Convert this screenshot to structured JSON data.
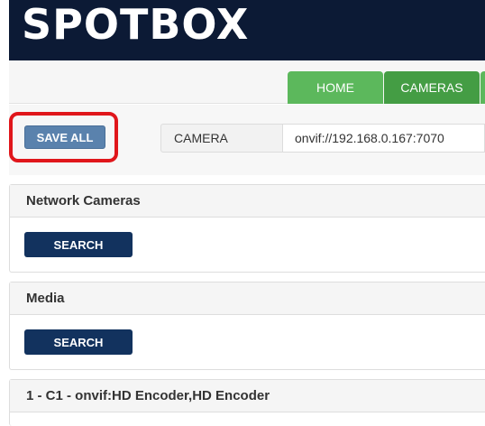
{
  "header": {
    "logo_text": "SPOTBOX"
  },
  "nav": {
    "tabs": [
      {
        "label": "HOME"
      },
      {
        "label": "CAMERAS"
      }
    ]
  },
  "toolbar": {
    "save_all_label": "SAVE ALL",
    "camera_label": "CAMERA",
    "camera_value": "onvif://192.168.0.167:7070"
  },
  "panels": {
    "network_cameras": {
      "title": "Network Cameras",
      "search_label": "SEARCH"
    },
    "media": {
      "title": "Media",
      "search_label": "SEARCH"
    },
    "device": {
      "title": "1 - C1 - onvif:HD Encoder,HD Encoder"
    }
  },
  "colors": {
    "header_bg": "#0c1a35",
    "tab_green": "#5cb85c",
    "tab_active": "#449d44",
    "save_button": "#5a82ad",
    "search_button": "#12325e",
    "highlight": "#e0161b"
  }
}
